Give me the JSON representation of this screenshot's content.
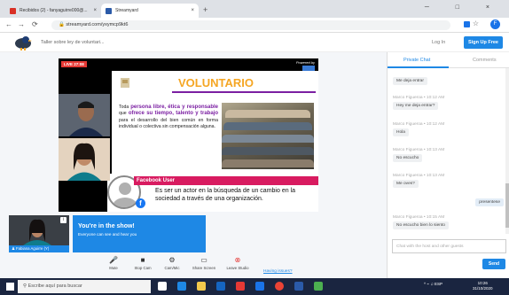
{
  "browser": {
    "tabs": [
      {
        "title": "Recibidos (2) - fanyaguirre000@...",
        "close": "×"
      },
      {
        "title": "Streamyard",
        "close": "×"
      }
    ],
    "new_tab": "+",
    "window_controls": "─ □ ×",
    "url": "streamyard.com/yxymcp9kt6"
  },
  "studio_bar": {
    "broadcast_title": "Taller sobre ley de voluntari...",
    "login": "Log In",
    "signup": "Sign Up Free"
  },
  "video": {
    "live_badge": "LIVE 27:08",
    "powered": "Powered by",
    "slide": {
      "title": "VOLUNTARIO",
      "body_html": "Toda <b>persona libre, ética y responsable</b> que <b>ofrece su tiempo, talento y trabajo</b> para el desarrollo del bien común en forma individual o colectiva sin compensación alguna."
    },
    "banner": {
      "name": "Facebook User",
      "text": "Es ser un actor en la búsqueda de un cambio en la sociedad a través de una organización.",
      "fb": "f"
    }
  },
  "self_view": {
    "name": "Fabiana Aguirre (Y)",
    "info": "i"
  },
  "in_show": {
    "title": "You're in the show!",
    "subtitle": "Everyone can see and hear you"
  },
  "controls": [
    {
      "label": "Mute",
      "icon": "microphone-icon",
      "glyph": "🎤"
    },
    {
      "label": "Stop Cam",
      "icon": "camera-icon",
      "glyph": "■"
    },
    {
      "label": "Cam/Mic",
      "icon": "gear-icon",
      "glyph": "⚙"
    },
    {
      "label": "Share Screen",
      "icon": "monitor-icon",
      "glyph": "▭"
    },
    {
      "label": "Leave Studio",
      "icon": "leave-icon",
      "glyph": "⊗"
    }
  ],
  "having_issues": "Having issues?",
  "chat": {
    "tabs": [
      "Private Chat",
      "Comments"
    ],
    "messages": [
      {
        "who": "",
        "text": "Me deja entrar"
      },
      {
        "who": "Marco Figueroa • 10:12 AM",
        "text": "Hey me deja entrar?"
      },
      {
        "who": "Marco Figueroa • 10:12 AM",
        "text": "Hola"
      },
      {
        "who": "Marco Figueroa • 10:13 AM",
        "text": "No escucho"
      },
      {
        "who": "Marco Figueroa • 10:13 AM",
        "text": "Me oves?"
      },
      {
        "who": "Marco Figueroa • 10:15 AM",
        "text": "No escucho bien lo siento"
      }
    ],
    "own_message": "presentese",
    "input_placeholder": "Chat with the host and other guests",
    "send": "Send"
  },
  "taskbar": {
    "search": "Escribe aquí para buscar",
    "tray": "^ ⌁ ♫ ESP",
    "time": "10:26",
    "date": "31/10/2020",
    "lang": "US"
  },
  "colors": {
    "accent": "#1e88e5",
    "live": "#e53935",
    "slide_title": "#f5a623",
    "slide_emphasis": "#7b1fa2",
    "banner": "#d81b60"
  }
}
